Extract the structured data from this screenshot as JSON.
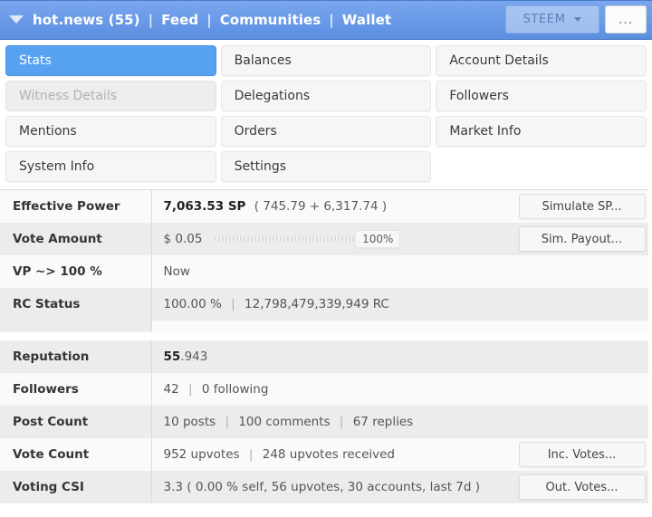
{
  "titlebar": {
    "caret_icon": "chevron-down-icon",
    "account": "hot.news (55)",
    "sep": "|",
    "links": [
      "Feed",
      "Communities",
      "Wallet"
    ],
    "chain": {
      "label": "STEEM",
      "caret_icon": "chevron-down-icon"
    },
    "menu_label": "...",
    "accent_color": "#6e9de9"
  },
  "tabs": [
    {
      "label": "Stats",
      "state": "active"
    },
    {
      "label": "Balances",
      "state": "normal"
    },
    {
      "label": "Account Details",
      "state": "normal"
    },
    {
      "label": "Witness Details",
      "state": "disabled"
    },
    {
      "label": "Delegations",
      "state": "normal"
    },
    {
      "label": "Followers",
      "state": "normal"
    },
    {
      "label": "Mentions",
      "state": "normal"
    },
    {
      "label": "Orders",
      "state": "normal"
    },
    {
      "label": "Market Info",
      "state": "normal"
    },
    {
      "label": "System Info",
      "state": "normal"
    },
    {
      "label": "Settings",
      "state": "normal"
    },
    {
      "label": "",
      "state": "empty"
    }
  ],
  "stats_top": {
    "effective_power": {
      "key": "Effective Power",
      "value_strong": "7,063.53 SP",
      "value_muted": "( 745.79 + 6,317.74 )",
      "button": "Simulate SP..."
    },
    "vote_amount": {
      "key": "Vote Amount",
      "amount": "$ 0.05",
      "meter_label": "100%",
      "meter_percent": 100,
      "button": "Sim. Payout..."
    },
    "vp_full": {
      "key": "VP ~> 100 %",
      "value": "Now"
    },
    "rc_status": {
      "key": "RC Status",
      "percent": "100.00 %",
      "sep": "|",
      "rc": "12,798,479,339,949 RC"
    }
  },
  "stats_bottom": {
    "reputation": {
      "key": "Reputation",
      "value_strong": "55",
      "value_muted": ".943"
    },
    "followers": {
      "key": "Followers",
      "count": "42",
      "sep": "|",
      "following": "0 following"
    },
    "post_count": {
      "key": "Post Count",
      "posts": "10 posts",
      "sep1": "|",
      "comments": "100 comments",
      "sep2": "|",
      "replies": "67 replies"
    },
    "vote_count": {
      "key": "Vote Count",
      "given": "952 upvotes",
      "sep": "|",
      "received": "248 upvotes received",
      "button": "Inc. Votes..."
    },
    "voting_csi": {
      "key": "Voting CSI",
      "value": "3.3 ( 0.00 % self, 56 upvotes, 30 accounts, last 7d )",
      "button": "Out. Votes..."
    }
  }
}
